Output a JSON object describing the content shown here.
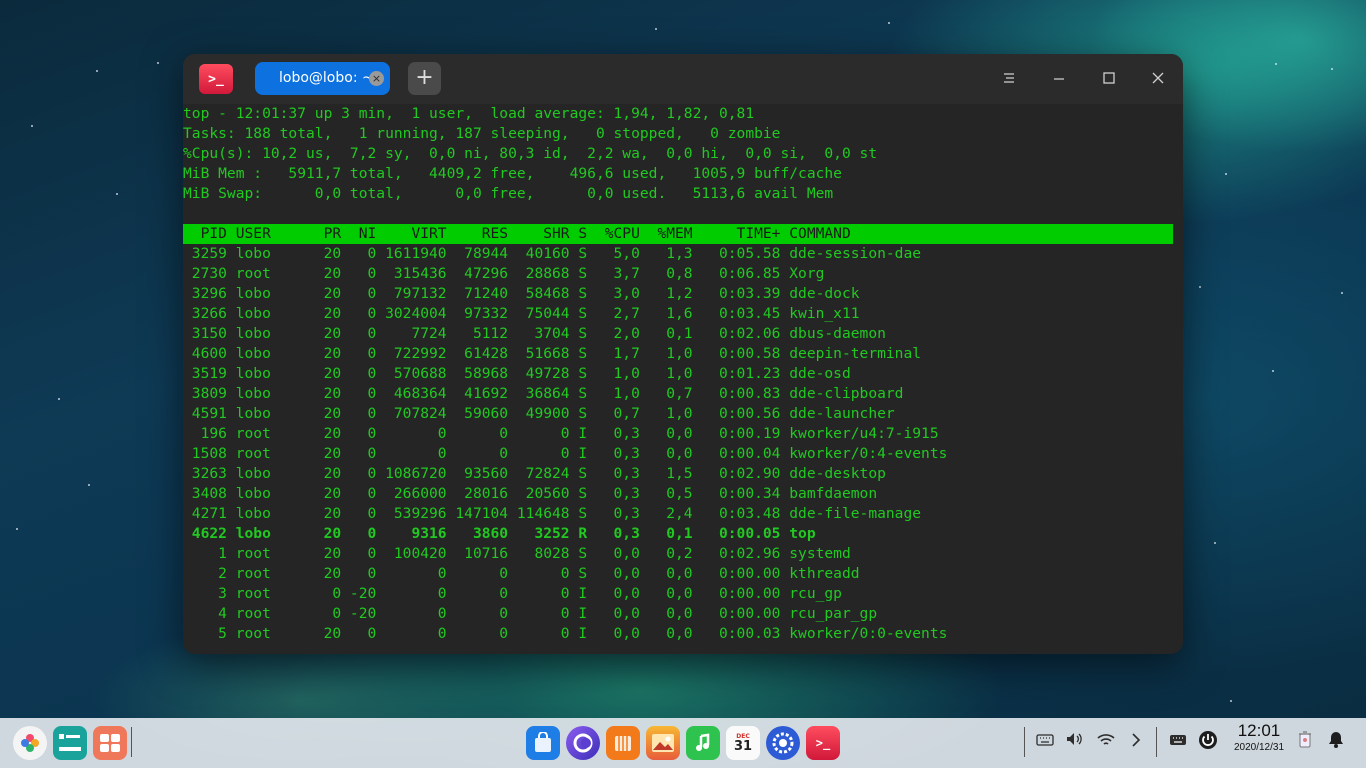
{
  "window": {
    "tab_label": "lobo@lobo: ~",
    "tab_close": "×",
    "new_tab": "+",
    "app_icon": ">_"
  },
  "top": {
    "summary": [
      "top - 12:01:37 up 3 min,  1 user,  load average: 1,94, 1,82, 0,81",
      "Tasks: 188 total,   1 running, 187 sleeping,   0 stopped,   0 zombie",
      "%Cpu(s): 10,2 us,  7,2 sy,  0,0 ni, 80,3 id,  2,2 wa,  0,0 hi,  0,0 si,  0,0 st",
      "MiB Mem :   5911,7 total,   4409,2 free,    496,6 used,   1005,9 buff/cache",
      "MiB Swap:      0,0 total,      0,0 free,      0,0 used.   5113,6 avail Mem"
    ],
    "header": "  PID USER      PR  NI    VIRT    RES    SHR S  %CPU  %MEM     TIME+ COMMAND",
    "processes": [
      " 3259 lobo      20   0 1611940  78944  40160 S   5,0   1,3   0:05.58 dde-session-dae",
      " 2730 root      20   0  315436  47296  28868 S   3,7   0,8   0:06.85 Xorg",
      " 3296 lobo      20   0  797132  71240  58468 S   3,0   1,2   0:03.39 dde-dock",
      " 3266 lobo      20   0 3024004  97332  75044 S   2,7   1,6   0:03.45 kwin_x11",
      " 3150 lobo      20   0    7724   5112   3704 S   2,0   0,1   0:02.06 dbus-daemon",
      " 4600 lobo      20   0  722992  61428  51668 S   1,7   1,0   0:00.58 deepin-terminal",
      " 3519 lobo      20   0  570688  58968  49728 S   1,0   1,0   0:01.23 dde-osd",
      " 3809 lobo      20   0  468364  41692  36864 S   1,0   0,7   0:00.83 dde-clipboard",
      " 4591 lobo      20   0  707824  59060  49900 S   0,7   1,0   0:00.56 dde-launcher",
      "  196 root      20   0       0      0      0 I   0,3   0,0   0:00.19 kworker/u4:7-i915",
      " 1508 root      20   0       0      0      0 I   0,3   0,0   0:00.04 kworker/0:4-events",
      " 3263 lobo      20   0 1086720  93560  72824 S   0,3   1,5   0:02.90 dde-desktop",
      " 3408 lobo      20   0  266000  28016  20560 S   0,3   0,5   0:00.34 bamfdaemon",
      " 4271 lobo      20   0  539296 147104 114648 S   0,3   2,4   0:03.48 dde-file-manage",
      " 4622 lobo      20   0    9316   3860   3252 R   0,3   0,1   0:00.05 top",
      "    1 root      20   0  100420  10716   8028 S   0,0   0,2   0:02.96 systemd",
      "    2 root      20   0       0      0      0 S   0,0   0,0   0:00.00 kthreadd",
      "    3 root       0 -20       0      0      0 I   0,0   0,0   0:00.00 rcu_gp",
      "    4 root       0 -20       0      0      0 I   0,0   0,0   0:00.00 rcu_par_gp",
      "    5 root      20   0       0      0      0 I   0,0   0,0   0:00.03 kworker/0:0-events"
    ]
  },
  "dock": {
    "apps": [
      {
        "name": "launcher",
        "color": "#ffffff"
      },
      {
        "name": "multitask-view",
        "color": "#1aa39a"
      },
      {
        "name": "desktop-toggle",
        "color": "#f0785a"
      },
      {
        "name": "app-store",
        "color": "#1f7de6"
      },
      {
        "name": "browser",
        "color": "#7b4ce0"
      },
      {
        "name": "file-manager",
        "color": "#f27a1a"
      },
      {
        "name": "image-viewer",
        "color": "#e85d3a"
      },
      {
        "name": "music",
        "color": "#2ec24f"
      },
      {
        "name": "calendar",
        "color": "#ffffff"
      },
      {
        "name": "control-center",
        "color": "#2d5bd6"
      },
      {
        "name": "terminal",
        "color": "#e8294a"
      }
    ],
    "calendar_month": "DEC",
    "calendar_day": "31",
    "clock_time": "12:01",
    "clock_date": "2020/12/31"
  }
}
